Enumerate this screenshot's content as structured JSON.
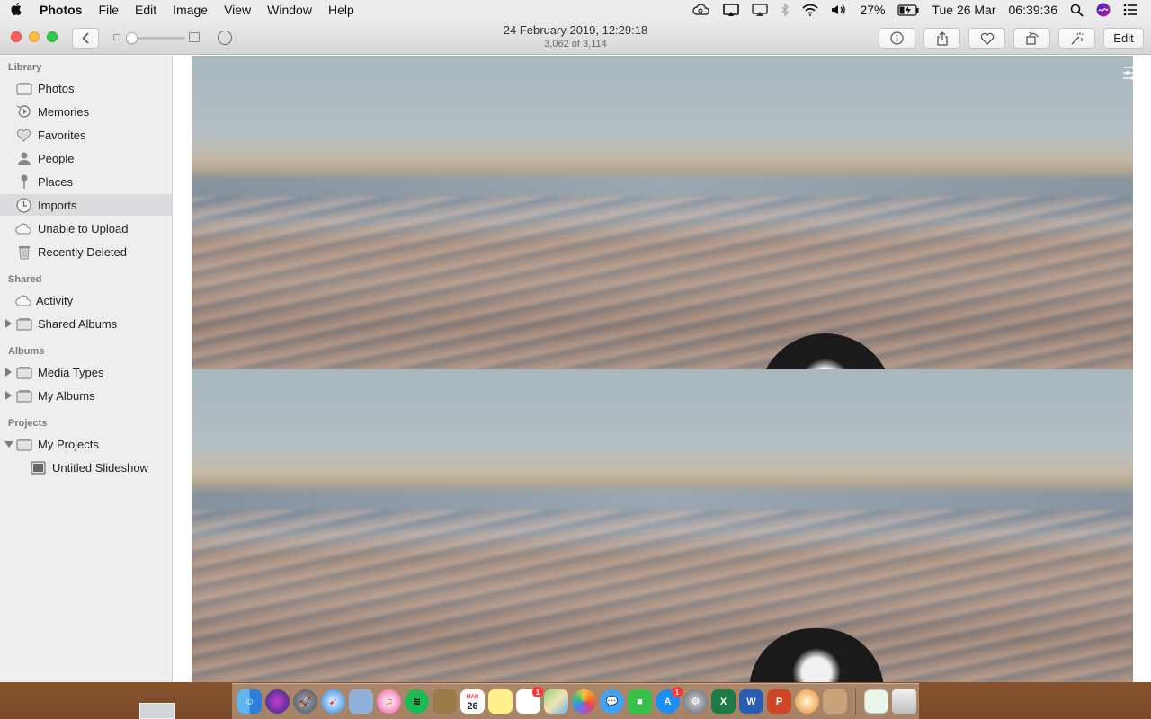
{
  "menubar": {
    "app_name": "Photos",
    "menus": [
      "File",
      "Edit",
      "Image",
      "View",
      "Window",
      "Help"
    ],
    "battery": "27%",
    "date": "Tue 26 Mar",
    "time": "06:39:36"
  },
  "titlebar": {
    "date_title": "24 February 2019, 12:29:18",
    "position": "3,062 of 3,114",
    "edit_label": "Edit"
  },
  "sidebar": {
    "library_header": "Library",
    "library_items": [
      "Photos",
      "Memories",
      "Favorites",
      "People",
      "Places",
      "Imports",
      "Unable to Upload",
      "Recently Deleted"
    ],
    "shared_header": "Shared",
    "shared_items": [
      "Activity",
      "Shared Albums"
    ],
    "albums_header": "Albums",
    "album_items": [
      "Media Types",
      "My Albums"
    ],
    "projects_header": "Projects",
    "project_items": [
      "My Projects",
      "Untitled Slideshow"
    ],
    "selected": "Imports"
  },
  "dock": {
    "calendar_day": "26",
    "calendar_month": "MAR",
    "reminders_badge": "1",
    "appstore_badge": "1",
    "apps": [
      "finder",
      "siri",
      "launchpad",
      "safari",
      "preview",
      "itunes",
      "spotify",
      "notebook",
      "calendar",
      "notes",
      "reminders",
      "maps",
      "photos",
      "messages",
      "facetime",
      "app-store",
      "system-preferences",
      "excel",
      "word",
      "powerpoint",
      "preview-2",
      "xcode-tools",
      "downloads",
      "trash"
    ]
  },
  "colors": {
    "close": "#fc605c",
    "minimize": "#fdbc40",
    "maximize": "#34c84a",
    "sidebar_bg": "#eeeeef",
    "selected_bg": "#dcdcde"
  }
}
